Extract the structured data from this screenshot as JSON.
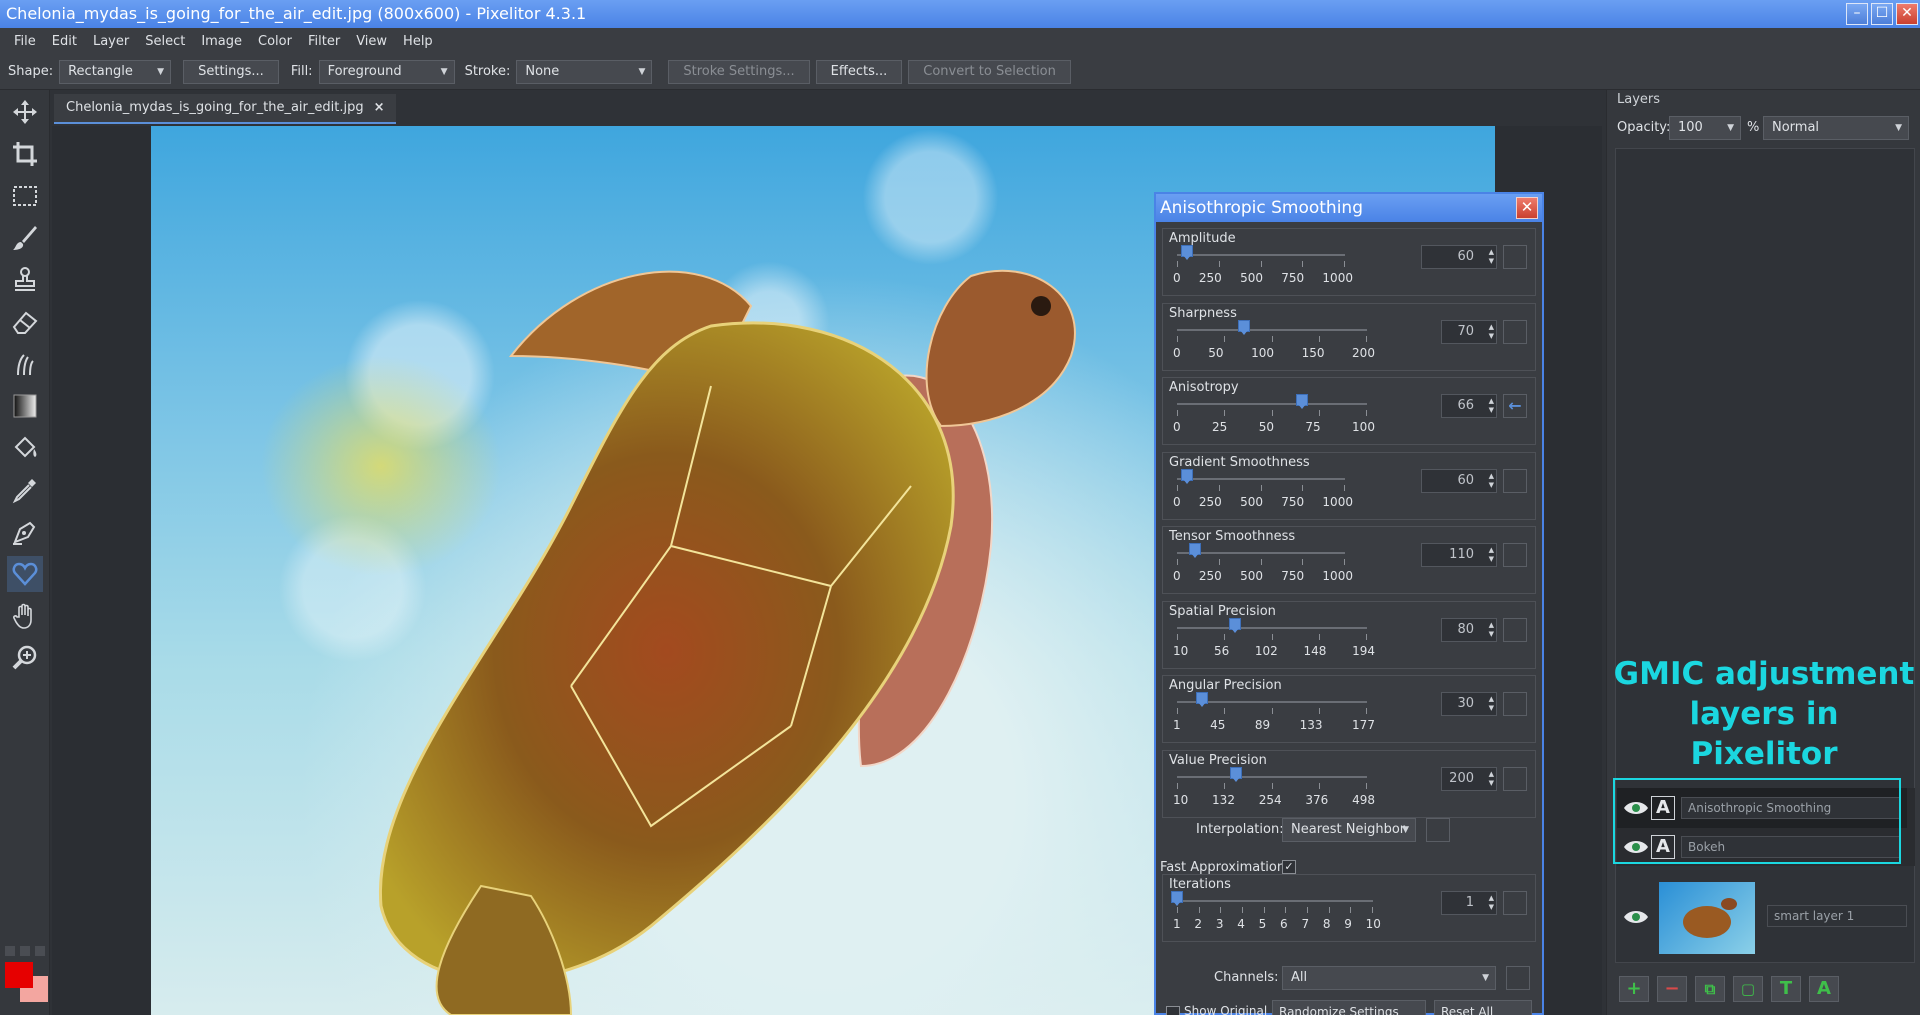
{
  "window": {
    "title": "Chelonia_mydas_is_going_for_the_air_edit.jpg (800x600) - Pixelitor 4.3.1",
    "min_glyph": "–",
    "max_glyph": "☐",
    "close_glyph": "✕"
  },
  "menu": [
    "File",
    "Edit",
    "Layer",
    "Select",
    "Image",
    "Color",
    "Filter",
    "View",
    "Help"
  ],
  "options": {
    "shape_label": "Shape:",
    "shape_value": "Rectangle",
    "settings_btn": "Settings...",
    "fill_label": "Fill:",
    "fill_value": "Foreground",
    "stroke_label": "Stroke:",
    "stroke_value": "None",
    "stroke_settings_btn": "Stroke Settings...",
    "effects_btn": "Effects...",
    "convert_btn": "Convert to Selection"
  },
  "tools": [
    "move-icon",
    "crop-icon",
    "selection-icon",
    "brush-icon",
    "clone-stamp-icon",
    "eraser-icon",
    "smudge-icon",
    "gradient-icon",
    "paint-bucket-icon",
    "color-picker-icon",
    "pen-icon",
    "shapes-icon",
    "hand-icon",
    "zoom-icon"
  ],
  "colors": {
    "foreground": "#e60000",
    "background": "#f3a6a0",
    "accent": "#5b8fd9",
    "annotation": "#1bd7e0"
  },
  "document_tab": {
    "label": "Chelonia_mydas_is_going_for_the_air_edit.jpg",
    "close_glyph": "×"
  },
  "layers_panel": {
    "title": "Layers",
    "opacity_label": "Opacity:",
    "opacity_value": "100",
    "percent": "%",
    "blend_mode": "Normal",
    "layers": [
      {
        "name": "Anisothropic Smoothing",
        "badge": "A"
      },
      {
        "name": "Bokeh",
        "badge": "A"
      },
      {
        "name": "smart layer 1"
      }
    ],
    "annotation": "GMIC adjustment layers in Pixelitor",
    "buttons": [
      "+",
      "−",
      "⧉",
      "▢",
      "T",
      "A"
    ]
  },
  "dialog": {
    "title": "Anisothropic Smoothing",
    "close_glyph": "✕",
    "params": [
      {
        "label": "Amplitude",
        "value": "60",
        "ticks": [
          "0",
          "250",
          "500",
          "750",
          "1000"
        ],
        "min": 0,
        "max": 1000,
        "current": 60
      },
      {
        "label": "Sharpness",
        "value": "70",
        "ticks": [
          "0",
          "50",
          "100",
          "150",
          "200"
        ],
        "min": 0,
        "max": 200,
        "current": 70
      },
      {
        "label": "Anisotropy",
        "value": "66",
        "ticks": [
          "0",
          "25",
          "50",
          "75",
          "100"
        ],
        "min": 0,
        "max": 100,
        "current": 66
      },
      {
        "label": "Gradient Smoothness",
        "value": "60",
        "ticks": [
          "0",
          "250",
          "500",
          "750",
          "1000"
        ],
        "min": 0,
        "max": 1000,
        "current": 60
      },
      {
        "label": "Tensor Smoothness",
        "value": "110",
        "ticks": [
          "0",
          "250",
          "500",
          "750",
          "1000"
        ],
        "min": 0,
        "max": 1000,
        "current": 110
      },
      {
        "label": "Spatial Precision",
        "value": "80",
        "ticks": [
          "10",
          "56",
          "102",
          "148",
          "194"
        ],
        "min": 10,
        "max": 240,
        "current": 80
      },
      {
        "label": "Angular Precision",
        "value": "30",
        "ticks": [
          "1",
          "45",
          "89",
          "133",
          "177"
        ],
        "min": 1,
        "max": 221,
        "current": 30
      },
      {
        "label": "Value Precision",
        "value": "200",
        "ticks": [
          "10",
          "132",
          "254",
          "376",
          "498"
        ],
        "min": 10,
        "max": 620,
        "current": 200
      }
    ],
    "interpolation_label": "Interpolation:",
    "interpolation_value": "Nearest Neighbor",
    "fast_approx_label": "Fast Approximation:",
    "fast_approx_checked": "✓",
    "iterations": {
      "label": "Iterations",
      "value": "1",
      "ticks": [
        "1",
        "2",
        "3",
        "4",
        "5",
        "6",
        "7",
        "8",
        "9",
        "10"
      ],
      "min": 1,
      "max": 10,
      "current": 1
    },
    "channels_label": "Channels:",
    "channels_value": "All",
    "show_original": "Show Original",
    "randomize": "Randomize Settings",
    "reset_all": "Reset All"
  }
}
